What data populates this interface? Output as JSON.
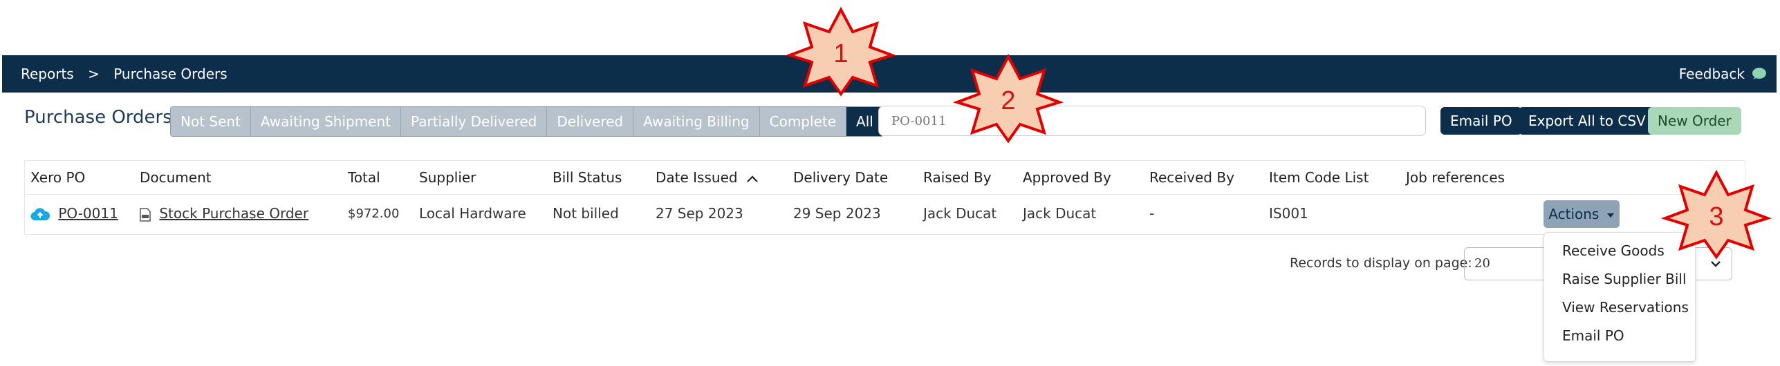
{
  "header": {
    "breadcrumb": [
      "Reports",
      ">",
      "Purchase Orders"
    ],
    "feedback": "Feedback"
  },
  "page_title": "Purchase Orders",
  "filter_tabs": [
    {
      "label": "Not Sent",
      "active": false
    },
    {
      "label": "Awaiting Shipment",
      "active": false
    },
    {
      "label": "Partially Delivered",
      "active": false
    },
    {
      "label": "Delivered",
      "active": false
    },
    {
      "label": "Awaiting Billing",
      "active": false
    },
    {
      "label": "Complete",
      "active": false
    },
    {
      "label": "All",
      "active": true
    }
  ],
  "search": {
    "value": "PO-0011"
  },
  "buttons": {
    "email_po": "Email PO",
    "export_csv": "Export All to CSV",
    "new_order": "New Order"
  },
  "table": {
    "columns": [
      "Xero PO",
      "Document",
      "Total",
      "Supplier",
      "Bill Status",
      "Date Issued",
      "Delivery Date",
      "Raised By",
      "Approved By",
      "Received By",
      "Item Code List",
      "Job references"
    ],
    "rows": [
      {
        "xero_po": "PO-0011",
        "document": "Stock Purchase Order",
        "total": "$972.00",
        "supplier": "Local Hardware",
        "bill_status": "Not billed",
        "date_issued": "27 Sep 2023",
        "delivery_date": "29 Sep 2023",
        "raised_by": "Jack Ducat",
        "approved_by": "Jack Ducat",
        "received_by": "-",
        "item_code_list": "IS001",
        "job_references": "",
        "actions": "Actions"
      }
    ]
  },
  "actions_menu": [
    "Receive Goods",
    "Raise Supplier Bill",
    "View Reservations",
    "Email PO"
  ],
  "records": {
    "label": "Records to display on page:",
    "value": "20"
  },
  "annotations": [
    "1",
    "2",
    "3"
  ],
  "colors": {
    "navy": "#0d2e4a",
    "tab_grey": "#b8c2cc",
    "green_btn": "#a8d8b8",
    "annotation_fill": "#f8ceb2",
    "annotation_stroke": "#e00000"
  }
}
